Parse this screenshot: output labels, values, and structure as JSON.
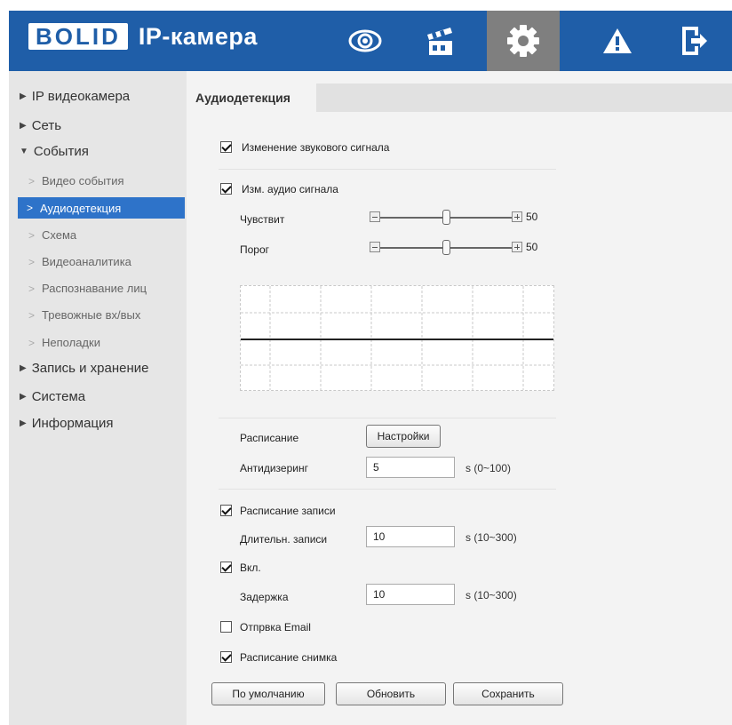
{
  "header": {
    "logo_text": "BOLID",
    "app_title": "IP-камера",
    "brand_color": "#1f5ea8",
    "nav": [
      {
        "icon": "eye-icon",
        "active": false
      },
      {
        "icon": "clapperboard-icon",
        "active": false
      },
      {
        "icon": "gear-icon",
        "active": true
      },
      {
        "icon": "warning-icon",
        "active": false
      },
      {
        "icon": "logout-icon",
        "active": false
      }
    ]
  },
  "sidebar": {
    "categories": [
      {
        "label": "IP видеокамера",
        "expanded": false
      },
      {
        "label": "Сеть",
        "expanded": false
      },
      {
        "label": "События",
        "expanded": true
      },
      {
        "label": "Запись и хранение",
        "expanded": false
      },
      {
        "label": "Система",
        "expanded": false
      },
      {
        "label": "Информация",
        "expanded": false
      }
    ],
    "event_items": [
      {
        "label": "Видео события",
        "active": false
      },
      {
        "label": "Аудиодетекция",
        "active": true
      },
      {
        "label": "Схема",
        "active": false
      },
      {
        "label": "Видеоаналитика",
        "active": false
      },
      {
        "label": "Распознавание лиц",
        "active": false
      },
      {
        "label": "Тревожные вх/вых",
        "active": false
      },
      {
        "label": "Неполадки",
        "active": false
      }
    ]
  },
  "tab": {
    "label": "Аудиодетекция"
  },
  "form": {
    "sound_change": {
      "label": "Изменение звукового сигнала",
      "checked": true
    },
    "audio_change": {
      "label": "Изм. аудио сигнала",
      "checked": true
    },
    "sensitivity": {
      "label": "Чувствит",
      "value": "50",
      "fraction": 0.5
    },
    "threshold": {
      "label": "Порог",
      "value": "50",
      "fraction": 0.5
    },
    "schedule": {
      "label": "Расписание",
      "button": "Настройки"
    },
    "antidither": {
      "label": "Антидизеринг",
      "value": "5",
      "unit": "s (0~100)"
    },
    "record_schedule": {
      "label": "Расписание записи",
      "checked": true
    },
    "record_duration": {
      "label": "Длительн. записи",
      "value": "10",
      "unit": "s (10~300)"
    },
    "enable": {
      "label": "Вкл.",
      "checked": true
    },
    "delay": {
      "label": "Задержка",
      "value": "10",
      "unit": "s (10~300)"
    },
    "send_email": {
      "label": "Отпрвка Email",
      "checked": false
    },
    "snapshot_schedule": {
      "label": "Расписание снимка",
      "checked": true
    }
  },
  "actions": {
    "default": "По умолчанию",
    "refresh": "Обновить",
    "save": "Сохранить"
  }
}
